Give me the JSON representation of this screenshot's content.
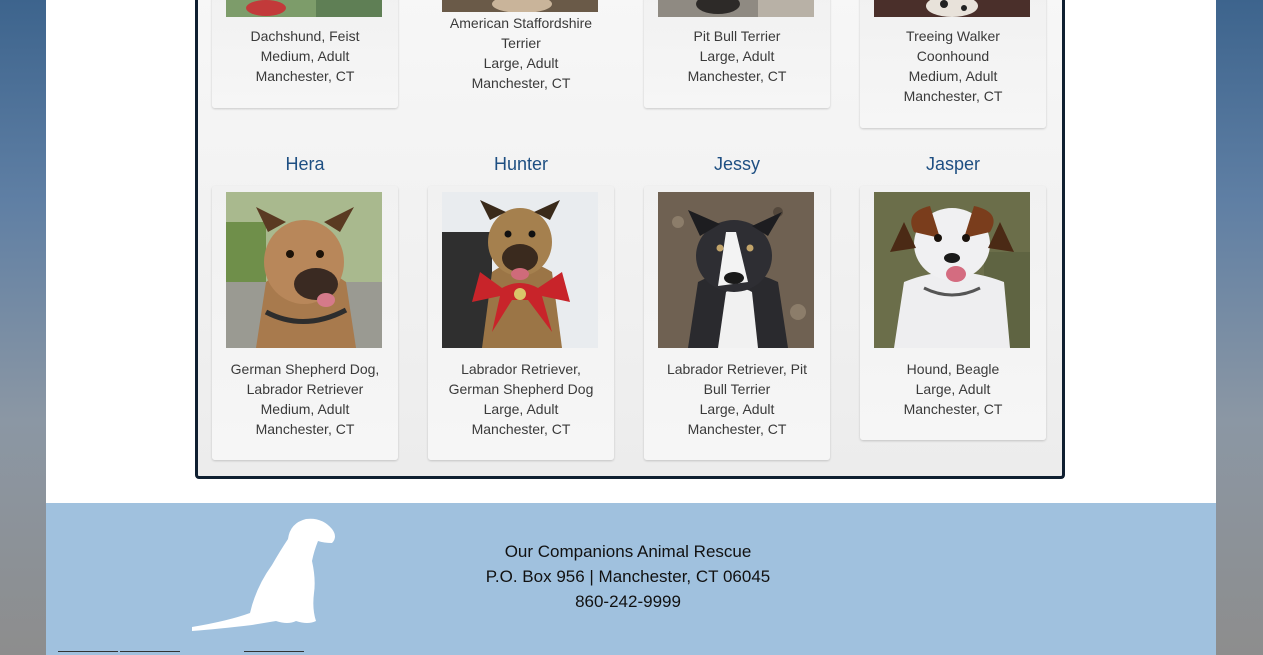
{
  "top_row": [
    {
      "breed": "Dachshund, Feist",
      "size_age": "Medium, Adult",
      "location": "Manchester, CT"
    },
    {
      "breed_1": "American Staffordshire",
      "breed_2": "Terrier",
      "size_age": "Large, Adult",
      "location": "Manchester, CT"
    },
    {
      "breed": "Pit Bull Terrier",
      "size_age": "Large, Adult",
      "location": "Manchester, CT"
    },
    {
      "breed_1": "Treeing Walker",
      "breed_2": "Coonhound",
      "size_age": "Medium, Adult",
      "location": "Manchester, CT"
    }
  ],
  "pets": [
    {
      "name": "Hera",
      "breed_1": "German Shepherd Dog,",
      "breed_2": "Labrador Retriever",
      "size_age": "Medium, Adult",
      "location": "Manchester, CT"
    },
    {
      "name": "Hunter",
      "breed_1": "Labrador Retriever,",
      "breed_2": "German Shepherd Dog",
      "size_age": "Large, Adult",
      "location": "Manchester, CT"
    },
    {
      "name": "Jessy",
      "breed_1": "Labrador Retriever, Pit",
      "breed_2": "Bull Terrier",
      "size_age": "Large, Adult",
      "location": "Manchester, CT"
    },
    {
      "name": "Jasper",
      "breed": "Hound, Beagle",
      "size_age": "Large, Adult",
      "location": "Manchester, CT"
    }
  ],
  "footer": {
    "org_name": "Our Companions Animal Rescue",
    "address": "P.O. Box 956 | Manchester, CT 06045",
    "phone": "860-242-9999",
    "logo_icon": "sitting-dog-silhouette-icon"
  },
  "colors": {
    "name_link": "#1e4f82",
    "footer_bg": "#a0c1de",
    "panel_border": "#0f1f30"
  }
}
